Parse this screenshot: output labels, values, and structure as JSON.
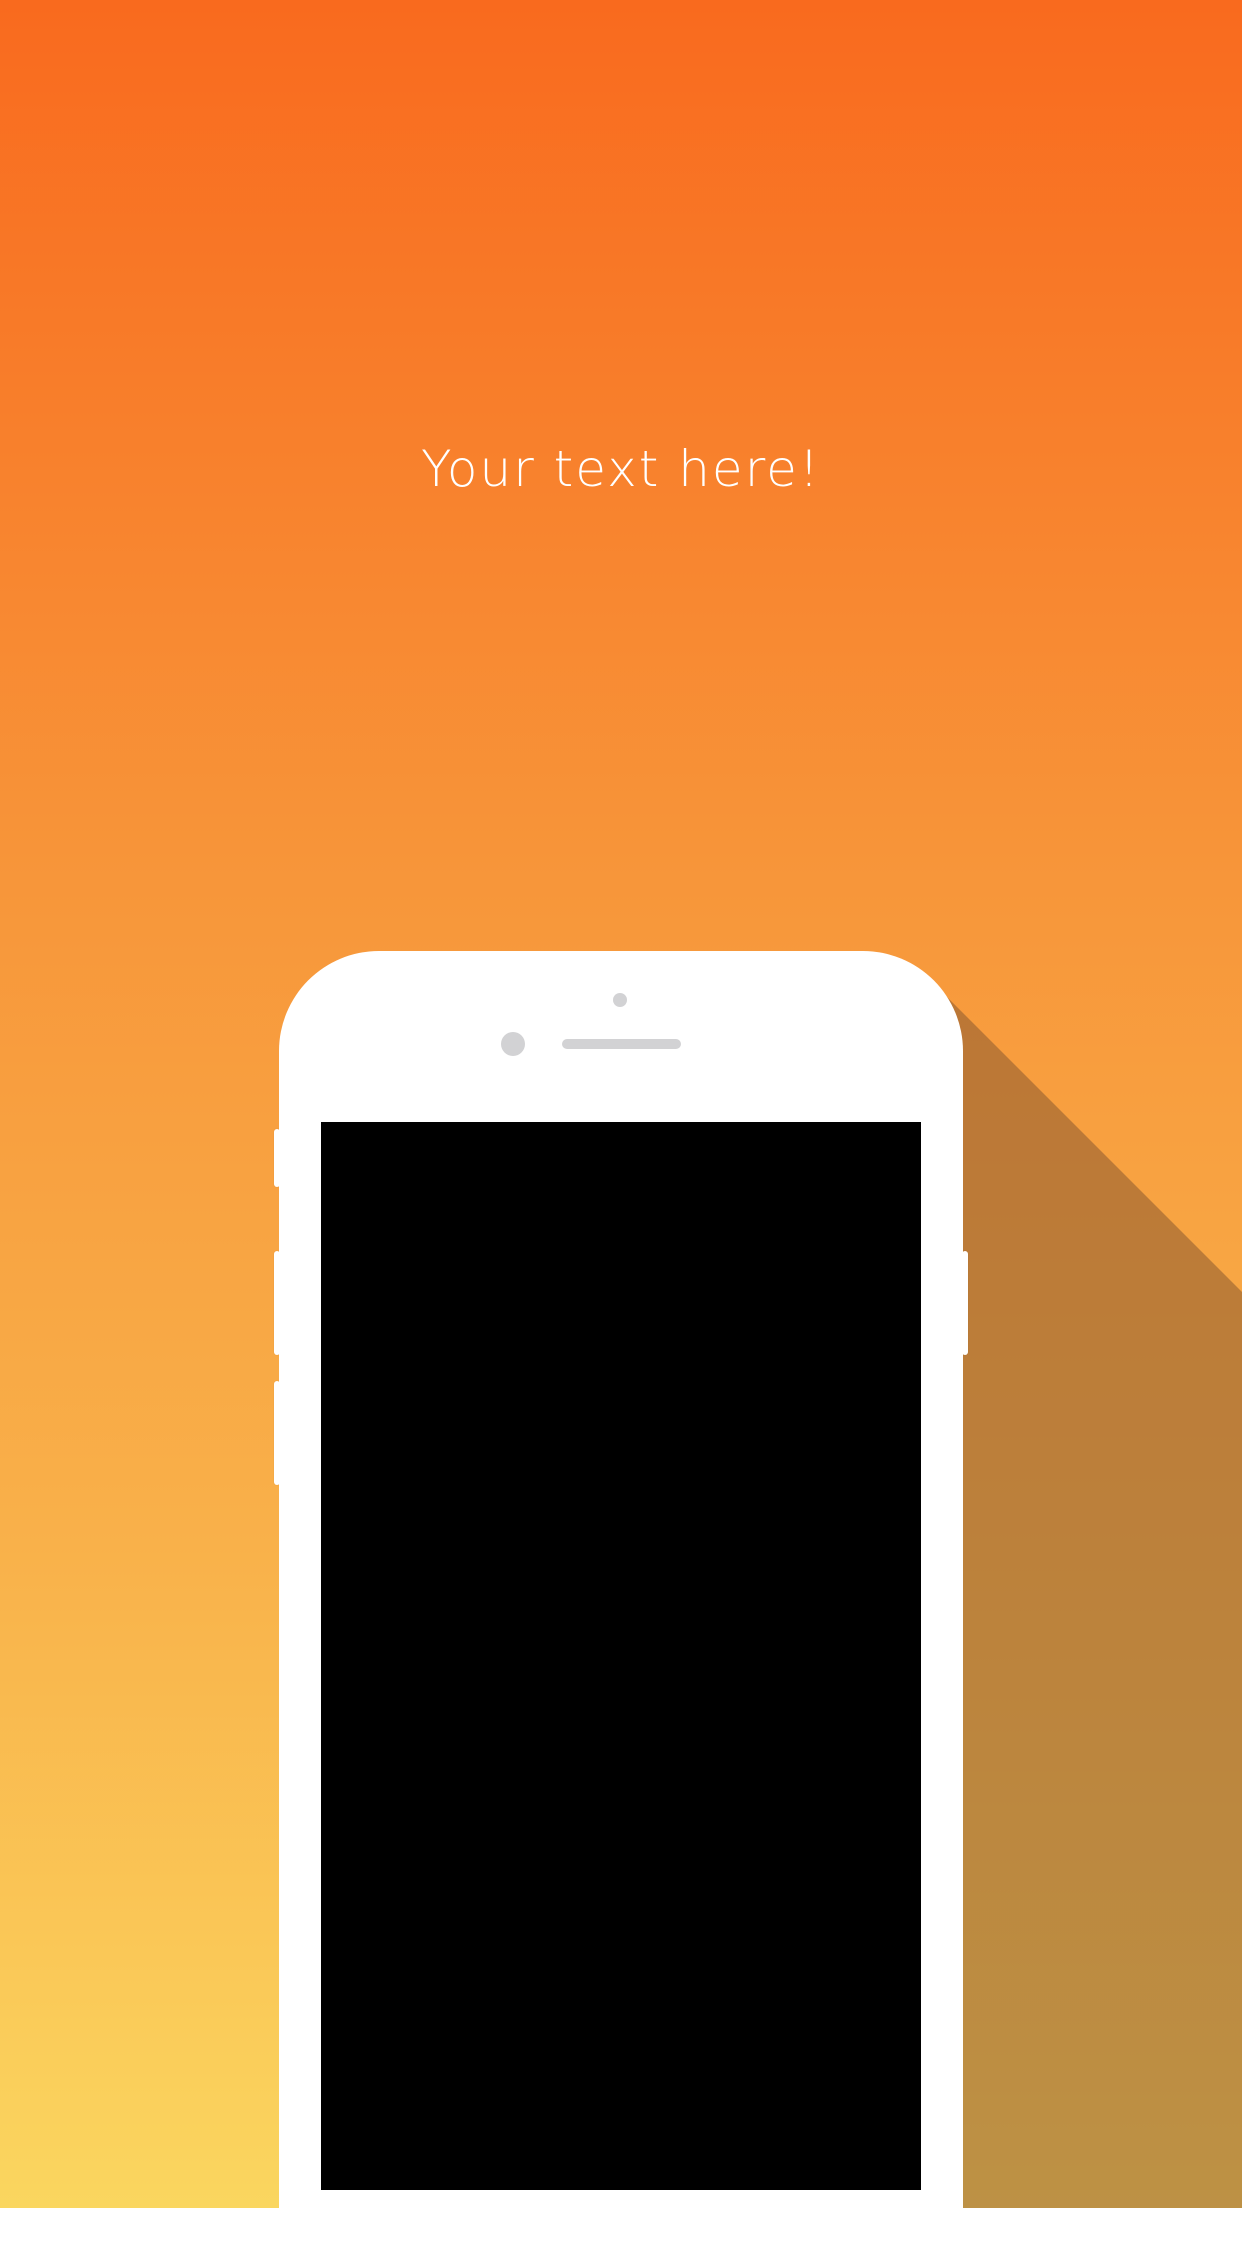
{
  "headline": {
    "text": "Your text here!"
  },
  "colors": {
    "gradient_top": "#f96a1e",
    "gradient_bottom": "#fad65f",
    "phone_body": "#ffffff",
    "screen": "#000000",
    "long_shadow": "#8a5a30"
  },
  "phone": {
    "icon": "smartphone-mockup-icon"
  }
}
